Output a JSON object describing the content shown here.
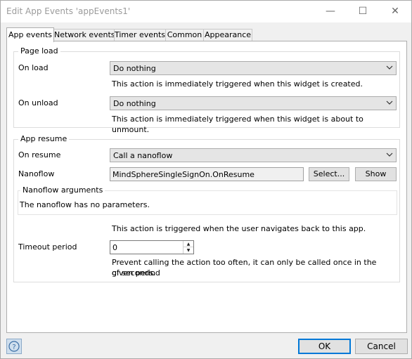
{
  "window": {
    "title": "Edit App Events 'appEvents1'",
    "minimize_glyph": "—",
    "maximize_glyph": "☐",
    "close_glyph": "✕"
  },
  "tabs": [
    {
      "label": "App events",
      "active": true
    },
    {
      "label": "Network events"
    },
    {
      "label": "Timer events"
    },
    {
      "label": "Common"
    },
    {
      "label": "Appearance"
    }
  ],
  "page_load": {
    "title": "Page load",
    "on_load_label": "On load",
    "on_load_value": "Do nothing",
    "on_load_note": "This action is immediately triggered when this widget is created.",
    "on_unload_label": "On unload",
    "on_unload_value": "Do nothing",
    "on_unload_note": "This action is immediately triggered when this widget is about to unmount."
  },
  "app_resume": {
    "title": "App resume",
    "on_resume_label": "On resume",
    "on_resume_value": "Call a nanoflow",
    "nanoflow_label": "Nanoflow",
    "nanoflow_value": "MindSphereSingleSignOn.OnResume",
    "select_button": "Select...",
    "show_button": "Show",
    "args_title": "Nanoflow arguments",
    "args_text": "The nanoflow has no parameters.",
    "trigger_note": "This action is triggered when the user navigates back to this app.",
    "timeout_label": "Timeout period",
    "timeout_value": "0",
    "timeout_note_1": "Prevent calling the action too often, it can only be called once in the given period",
    "timeout_note_2": "of seconds."
  },
  "footer": {
    "ok": "OK",
    "cancel": "Cancel"
  },
  "colors": {
    "accent": "#0078d7",
    "select_bg": "#e5e5e5",
    "window_bg": "#f0f0f0"
  },
  "icons": [
    "help-icon",
    "chevron-down-icon",
    "minimize-icon",
    "maximize-icon",
    "close-icon"
  ]
}
